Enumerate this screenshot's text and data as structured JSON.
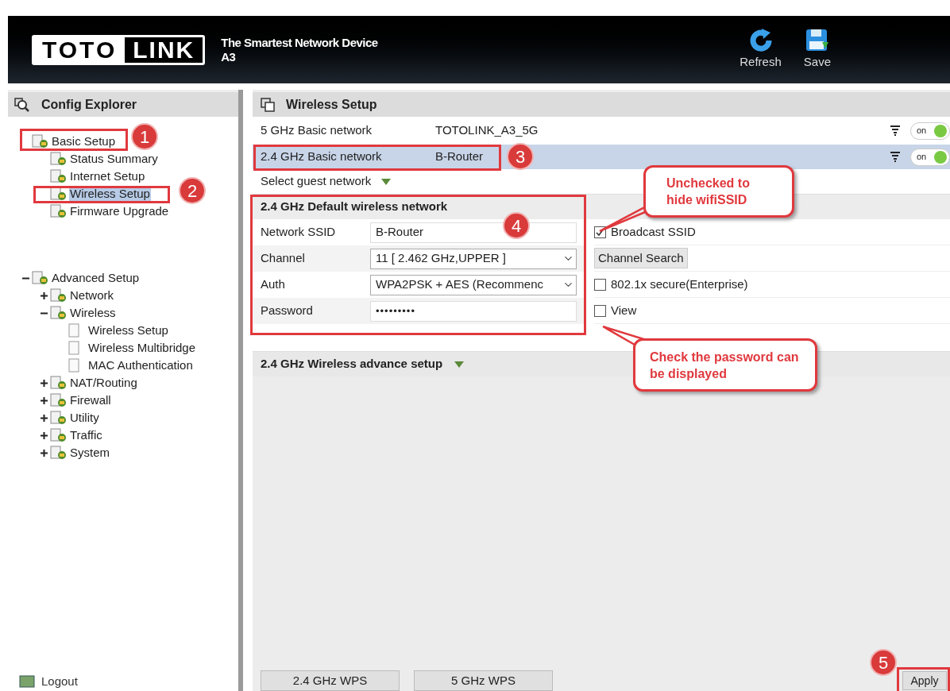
{
  "header": {
    "logo_left": "TOTO",
    "logo_right": "LINK",
    "tagline": "The Smartest Network Device",
    "model": "A3",
    "actions": [
      {
        "label": "Refresh",
        "kind": "refresh"
      },
      {
        "label": "Save",
        "kind": "save"
      }
    ]
  },
  "sidebar": {
    "title": "Config Explorer",
    "tree": [
      {
        "label": "Basic Setup",
        "selected": false,
        "children": [
          {
            "label": "Status Summary",
            "selected": false
          },
          {
            "label": "Internet Setup",
            "selected": false
          },
          {
            "label": "Wireless Setup",
            "selected": true
          },
          {
            "label": "Firmware Upgrade",
            "selected": false
          }
        ]
      },
      {
        "label": "Advanced Setup",
        "selected": false,
        "expanded": true,
        "children": [
          {
            "label": "Network",
            "selected": false,
            "expanded": false
          },
          {
            "label": "Wireless",
            "selected": false,
            "expanded": true,
            "children": [
              {
                "label": "Wireless Setup",
                "selected": false
              },
              {
                "label": "Wireless Multibridge",
                "selected": false
              },
              {
                "label": "MAC Authentication",
                "selected": false
              }
            ]
          },
          {
            "label": "NAT/Routing",
            "selected": false,
            "expanded": false
          },
          {
            "label": "Firewall",
            "selected": false,
            "expanded": false
          },
          {
            "label": "Utility",
            "selected": false,
            "expanded": false
          },
          {
            "label": "Traffic",
            "selected": false,
            "expanded": false
          },
          {
            "label": "System",
            "selected": false,
            "expanded": false
          }
        ]
      }
    ],
    "logout": "Logout"
  },
  "main": {
    "title": "Wireless Setup",
    "networks": [
      {
        "band": "5 GHz Basic network",
        "ssid": "TOTOLINK_A3_5G",
        "selected": false,
        "on": true,
        "switch_label": "on"
      },
      {
        "band": "2.4 GHz Basic network",
        "ssid": "B-Router",
        "selected": true,
        "on": true,
        "switch_label": "on"
      }
    ],
    "guest_link": "Select guest network",
    "section_title": "2.4 GHz Default wireless network",
    "fields": [
      {
        "label": "Network SSID",
        "kind": "text",
        "value": "B-Router"
      },
      {
        "label": "Channel",
        "kind": "select",
        "value": "11 [ 2.462 GHz,UPPER ]"
      },
      {
        "label": "Auth",
        "kind": "select",
        "value": "WPA2PSK + AES (Recommenc"
      },
      {
        "label": "Password",
        "kind": "password",
        "value": "•••••••••"
      }
    ],
    "options": [
      {
        "kind": "checkbox",
        "label": "Broadcast SSID",
        "checked": true
      },
      {
        "kind": "button",
        "label": "Channel Search"
      },
      {
        "kind": "checkbox",
        "label": "802.1x secure(Enterprise)",
        "checked": false
      },
      {
        "kind": "checkbox",
        "label": "View",
        "checked": false
      }
    ],
    "advance_title": "2.4 GHz Wireless advance setup",
    "wps_buttons": [
      "2.4 GHz WPS",
      "5 GHz WPS"
    ],
    "apply": "Apply"
  },
  "annotations": {
    "markers": [
      "1",
      "2",
      "3",
      "4",
      "5"
    ],
    "callouts": [
      "Unchecked to hide wifiSSID",
      "Check the password can be displayed"
    ]
  }
}
